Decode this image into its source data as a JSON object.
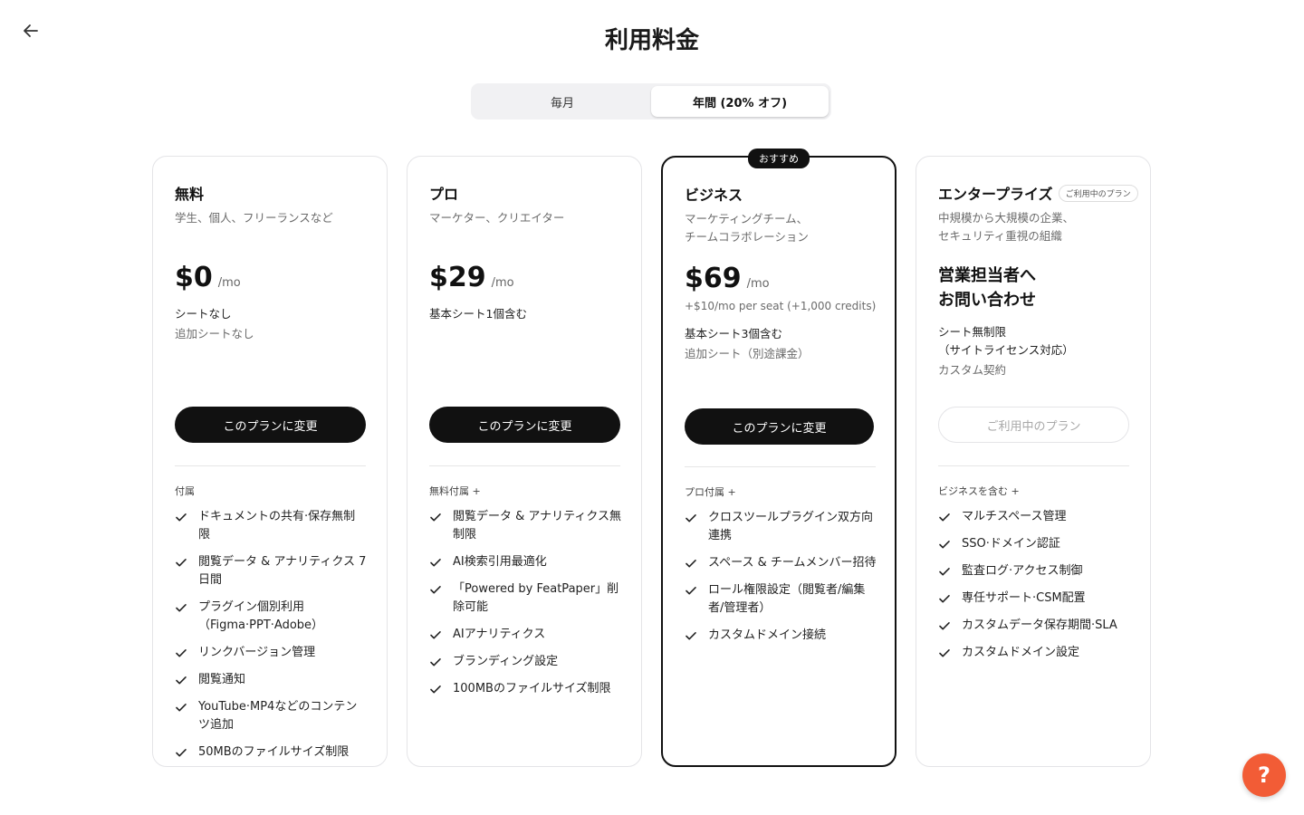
{
  "page_title": "利用料金",
  "billing_toggle": {
    "monthly_label": "毎月",
    "annual_label": "年間 (20% オフ)",
    "selected": "annual"
  },
  "plans": [
    {
      "name": "無料",
      "description": "学生、個人、フリーランスなど",
      "price": "$0",
      "per": "/mo",
      "seats": "シートなし",
      "extra_seats": "追加シートなし",
      "cta": "このプランに変更",
      "features_heading": "付属",
      "features": [
        "ドキュメントの共有·保存無制限",
        "閲覧データ & アナリティクス 7日間",
        "プラグイン個別利用（Figma·PPT·Adobe）",
        "リンクバージョン管理",
        "閲覧通知",
        "YouTube·MP4などのコンテンツ追加",
        "50MBのファイルサイズ制限"
      ]
    },
    {
      "name": "プロ",
      "description": "マーケター、クリエイター",
      "price": "$29",
      "per": "/mo",
      "seats": "基本シート1個含む",
      "cta": "このプランに変更",
      "features_heading": "無料付属 +",
      "features": [
        "閲覧データ & アナリティクス無制限",
        "AI検索引用最適化",
        "「Powered by FeatPaper」削除可能",
        "AIアナリティクス",
        "ブランディング設定",
        "100MBのファイルサイズ制限"
      ]
    },
    {
      "name": "ビジネス",
      "badge": "おすすめ",
      "description_1": "マーケティングチーム、",
      "description_2": "チームコラボレーション",
      "price": "$69",
      "per": "/mo",
      "seat_note": "+$10/mo per seat (+1,000 credits)",
      "seats": "基本シート3個含む",
      "extra_seats": "追加シート（別途課金）",
      "cta": "このプランに変更",
      "features_heading": "プロ付属 +",
      "features": [
        "クロスツールプラグイン双方向連携",
        "スペース & チームメンバー招待",
        "ロール権限設定（閲覧者/編集者/管理者）",
        "カスタムドメイン接続"
      ]
    },
    {
      "name": "エンタープライズ",
      "current_tag": "ご利用中のプラン",
      "description_1": "中規模から大規模の企業、",
      "description_2": "セキュリティ重視の組織",
      "contact_1": "営業担当者へ",
      "contact_2": "お問い合わせ",
      "seats_1": "シート無制限",
      "seats_2": "（サイトライセンス対応）",
      "contract": "カスタム契約",
      "cta": "ご利用中のプラン",
      "features_heading": "ビジネスを含む +",
      "features": [
        "マルチスペース管理",
        "SSO·ドメイン認証",
        "監査ログ·アクセス制御",
        "専任サポート·CSM配置",
        "カスタムデータ保存期間·SLA",
        "カスタムドメイン設定"
      ]
    }
  ],
  "help_button": "?",
  "colors": {
    "accent_help": "#f25c36",
    "primary_button": "#111111",
    "toggle_bg": "#f1f1f3"
  },
  "icons": {
    "back": "arrow-left-icon",
    "check": "check-icon"
  }
}
